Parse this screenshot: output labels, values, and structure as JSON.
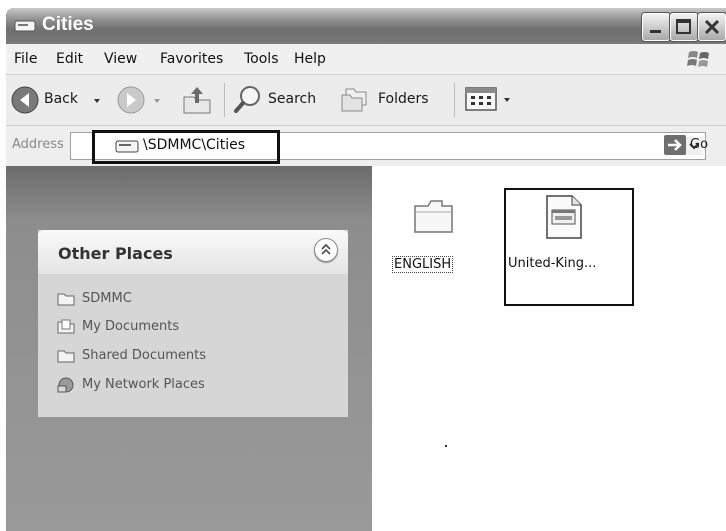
{
  "window": {
    "title": "Cities",
    "controls": [
      "minimize-icon",
      "maximize-icon",
      "close-icon"
    ]
  },
  "menu": {
    "items": [
      "File",
      "Edit",
      "View",
      "Favorites",
      "Tools",
      "Help"
    ]
  },
  "toolbar": {
    "back_label": "Back",
    "search_label": "Search",
    "folders_label": "Folders",
    "icons": [
      "back-arrow-icon",
      "forward-arrow-icon",
      "up-folder-icon",
      "search-icon",
      "folders-icon",
      "views-icon"
    ]
  },
  "address": {
    "label": "Address",
    "path": "\\SDMMC\\Cities",
    "go_label": "Go"
  },
  "other_places": {
    "title": "Other Places",
    "items": [
      {
        "label": "SDMMC",
        "icon": "folder-icon"
      },
      {
        "label": "My Documents",
        "icon": "my-documents-icon"
      },
      {
        "label": "Shared Documents",
        "icon": "folder-icon"
      },
      {
        "label": "My Network Places",
        "icon": "network-places-icon"
      }
    ]
  },
  "files": [
    {
      "name": "ENGLISH",
      "type": "folder",
      "icon": "folder-icon"
    },
    {
      "name": "United-King...",
      "type": "file",
      "icon": "document-icon"
    }
  ],
  "colors": {
    "titlebar": "#7a7a7a",
    "left_pane": "#8d8d8d",
    "highlight_border": "#111111"
  }
}
